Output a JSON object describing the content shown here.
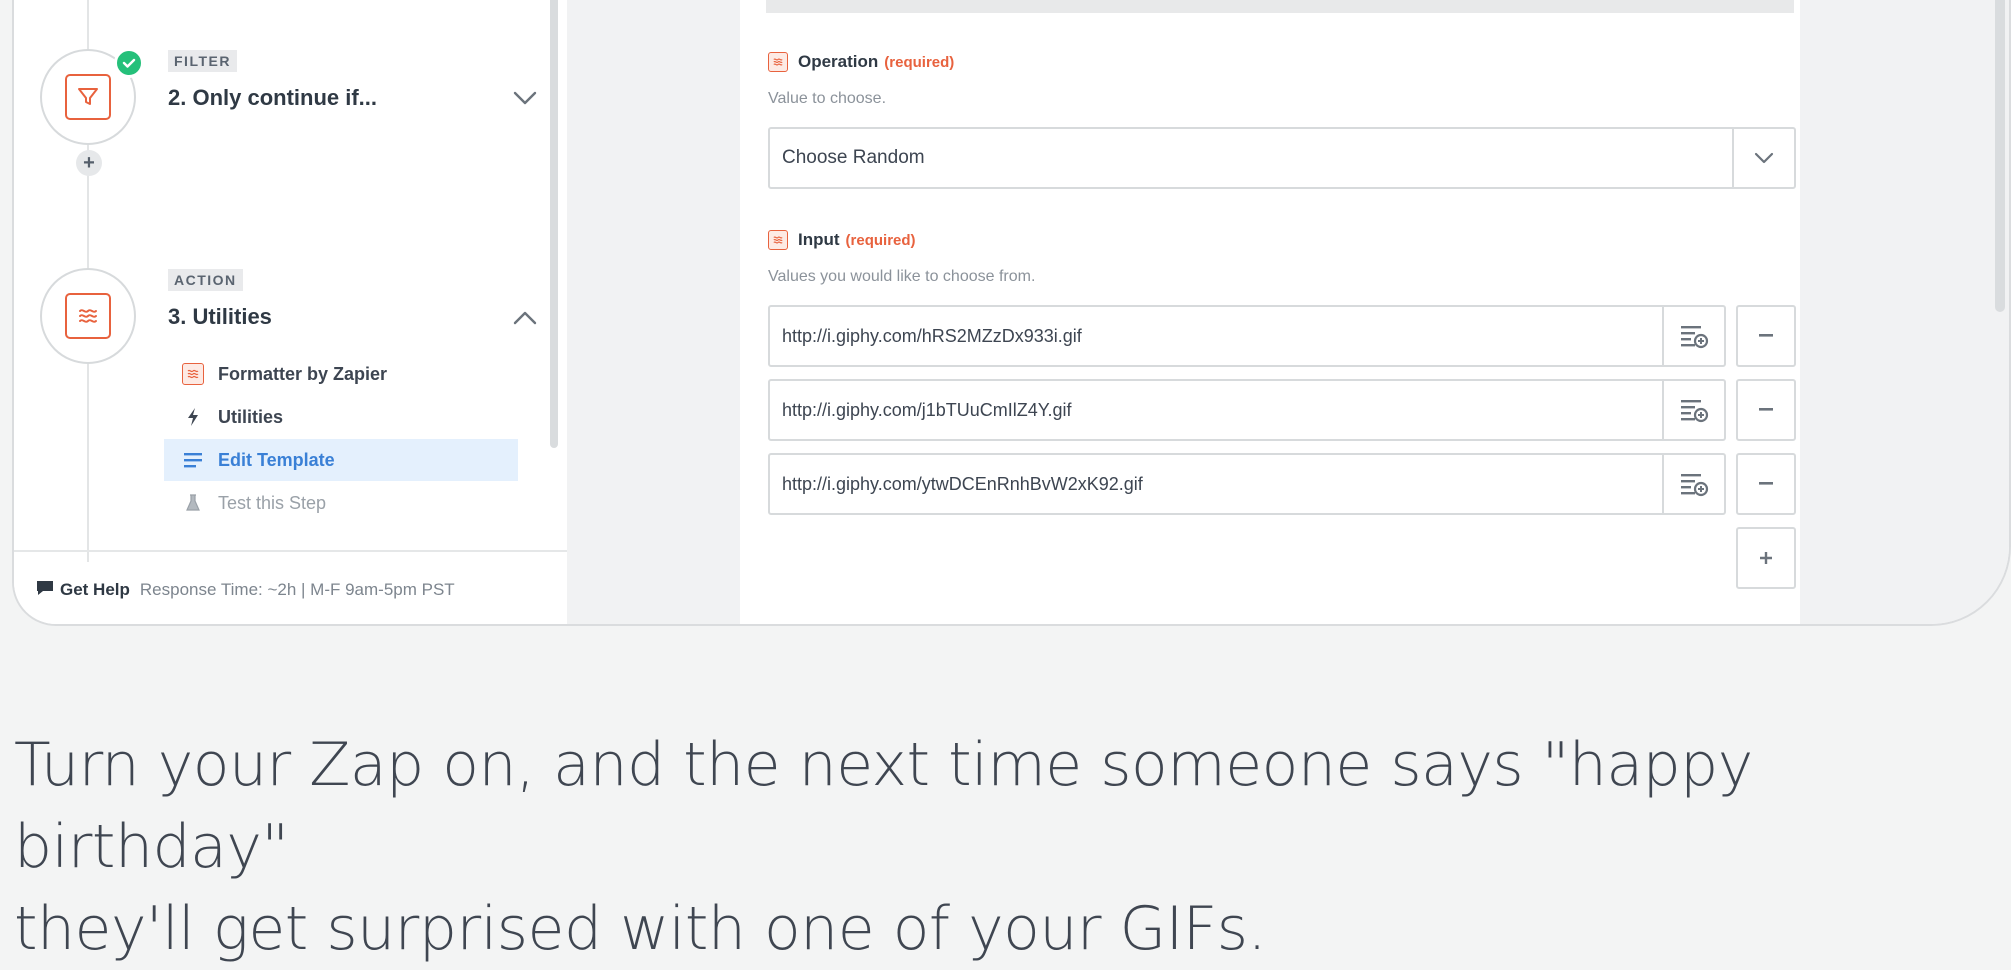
{
  "sidebar": {
    "steps": [
      {
        "tag": "FILTER",
        "title": "2. Only continue if...",
        "completed": true
      },
      {
        "tag": "ACTION",
        "title": "3. Utilities",
        "completed": false
      }
    ],
    "sub_items": [
      {
        "label": "Formatter by Zapier",
        "icon": "formatter-icon",
        "state": "normal"
      },
      {
        "label": "Utilities",
        "icon": "lightning-icon",
        "state": "normal"
      },
      {
        "label": "Edit Template",
        "icon": "list-icon",
        "state": "active"
      },
      {
        "label": "Test this Step",
        "icon": "flask-icon",
        "state": "muted"
      }
    ],
    "help": {
      "label": "Get Help",
      "response": "Response Time: ~2h | M-F 9am-5pm PST"
    }
  },
  "form": {
    "operation": {
      "label": "Operation",
      "required": "(required)",
      "help": "Value to choose.",
      "value": "Choose Random"
    },
    "input": {
      "label": "Input",
      "required": "(required)",
      "help": "Values you would like to choose from.",
      "values": [
        "http://i.giphy.com/hRS2MZzDx933i.gif",
        "http://i.giphy.com/j1bTUuCmIlZ4Y.gif",
        "http://i.giphy.com/ytwDCEnRnhBvW2xK92.gif"
      ]
    }
  },
  "caption": {
    "line1": "Turn your Zap on, and the next time someone says \"happy birthday\"",
    "line2": "they'll get surprised with one of your GIFs."
  },
  "colors": {
    "accent": "#e8623e",
    "success": "#25c07a",
    "active": "#3a80d6"
  }
}
